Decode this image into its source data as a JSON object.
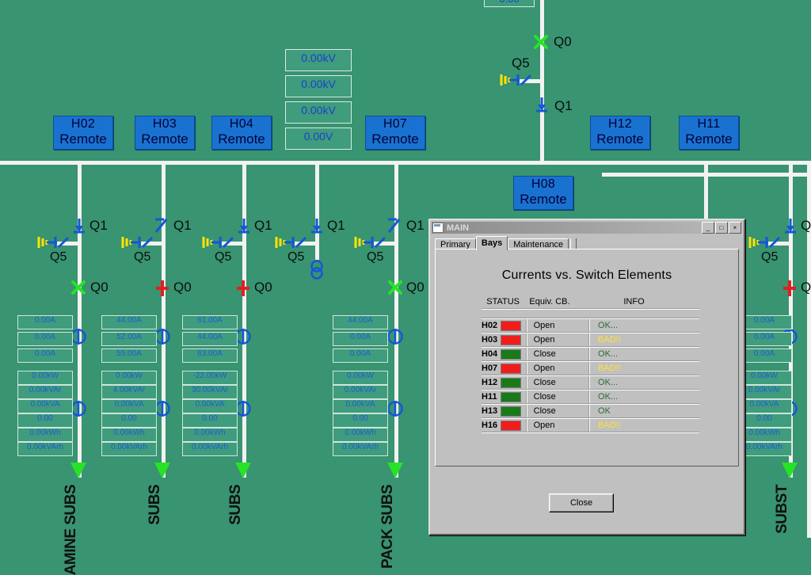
{
  "mimic": {
    "background_color": "#389471",
    "wire_color": "#f2f2f2",
    "voltage_boxes": [
      {
        "value": "0.00kV"
      },
      {
        "value": "0.00kV"
      },
      {
        "value": "0.00kV"
      },
      {
        "value": "0.00V"
      }
    ],
    "top_partial_box": "0.00",
    "incomer": {
      "q0_label": "Q0",
      "q5_label": "Q5",
      "q1_label": "Q1",
      "q0_state": "closed-green"
    },
    "bay_buttons": [
      {
        "id": "H02",
        "state": "Remote"
      },
      {
        "id": "H03",
        "state": "Remote"
      },
      {
        "id": "H04",
        "state": "Remote"
      },
      {
        "id": "H07",
        "state": "Remote"
      },
      {
        "id": "H12",
        "state": "Remote"
      },
      {
        "id": "H11",
        "state": "Remote"
      },
      {
        "id": "H08",
        "state": "Remote"
      }
    ],
    "switch_labels": {
      "q0": "Q0",
      "q1": "Q1",
      "q5": "Q5"
    },
    "bays": [
      {
        "name": "bay-h02",
        "q0_color": "#27e327",
        "currents": [
          "0.00A",
          "0.00A",
          "0.00A"
        ],
        "power": [
          "0.00kW",
          "0.00kVAr",
          "0.00kVA",
          "0.00",
          "0.00kWh",
          "0.00kVArh"
        ],
        "feeder": "AMINE SUBS"
      },
      {
        "name": "bay-h03",
        "q0_color": "#e02020",
        "currents": [
          "44.00A",
          "52.00A",
          "55.00A"
        ],
        "power": [
          "0.00kW",
          "4.00kVAr",
          "0.00kVA",
          "0.00",
          "0.00kWh",
          "0.00kVArh"
        ],
        "feeder": "SUBS"
      },
      {
        "name": "bay-h04",
        "q0_color": "#e02020",
        "currents": [
          "61.00A",
          "44.00A",
          "63.00A"
        ],
        "power": [
          "-22.00kW",
          "30.00kVAr",
          "0.00kVA",
          "0.00",
          "0.00kWh",
          "0.00kVArh"
        ],
        "feeder": "SUBS"
      },
      {
        "name": "bay-coupler",
        "q0_color": "none",
        "currents": [],
        "power": [],
        "feeder": ""
      },
      {
        "name": "bay-h07",
        "q0_color": "#27e327",
        "currents": [
          "44.00A",
          "0.00A",
          "0.00A"
        ],
        "power": [
          "0.00kW",
          "0.00kVAr",
          "0.00kVA",
          "0.00",
          "0.00kWh",
          "0.00kVArh"
        ],
        "feeder": "PACK SUBS"
      },
      {
        "name": "bay-right-partial",
        "q0_color": "#e02020",
        "currents": [
          "0.00A",
          "0.00A",
          "0.00A"
        ],
        "power": [
          "0.00kW",
          "0.00kVAr",
          "0.00kVA",
          "0.00",
          "0.00kWh",
          "0.00kVArh"
        ],
        "feeder": "SUBST"
      }
    ]
  },
  "dialog": {
    "title": "MAIN",
    "window_buttons": {
      "minimize": "_",
      "maximize": "□",
      "close": "×"
    },
    "tabs": [
      {
        "label": "Primary",
        "active": false
      },
      {
        "label": "Bays",
        "active": true
      },
      {
        "label": "Maintenance",
        "active": false
      }
    ],
    "heading": "Currents vs. Switch Elements",
    "table": {
      "columns": [
        "STATUS",
        "Equiv. CB.",
        "INFO"
      ],
      "rows": [
        {
          "bay": "H02",
          "status_color": "#f01d1d",
          "cb": "Open",
          "info": "OK...",
          "info_kind": "ok"
        },
        {
          "bay": "H03",
          "status_color": "#f01d1d",
          "cb": "Open",
          "info": "BAD!!",
          "info_kind": "bad"
        },
        {
          "bay": "H04",
          "status_color": "#1a7a1a",
          "cb": "Close",
          "info": "OK...",
          "info_kind": "ok"
        },
        {
          "bay": "H07",
          "status_color": "#f01d1d",
          "cb": "Open",
          "info": "BAD!!",
          "info_kind": "bad"
        },
        {
          "bay": "H12",
          "status_color": "#1a7a1a",
          "cb": "Close",
          "info": "OK...",
          "info_kind": "ok"
        },
        {
          "bay": "H11",
          "status_color": "#1a7a1a",
          "cb": "Close",
          "info": "OK...",
          "info_kind": "ok"
        },
        {
          "bay": "H13",
          "status_color": "#1a7a1a",
          "cb": "Close",
          "info": "OK",
          "info_kind": "ok"
        },
        {
          "bay": "H16",
          "status_color": "#f01d1d",
          "cb": "Open",
          "info": "BAD!!",
          "info_kind": "bad"
        }
      ]
    },
    "close_button": "Close"
  }
}
